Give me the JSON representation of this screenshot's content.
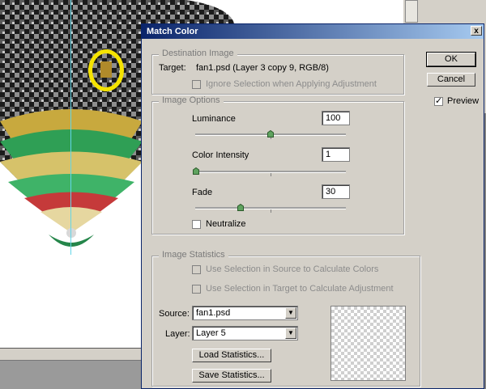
{
  "dialog": {
    "title": "Match Color",
    "close_glyph": "x",
    "ok_label": "OK",
    "cancel_label": "Cancel",
    "preview_label": "Preview",
    "preview_checked": true
  },
  "destination": {
    "legend": "Destination Image",
    "target_label": "Target:",
    "target_value": "fan1.psd (Layer 3 copy 9, RGB/8)",
    "ignore_selection_label": "Ignore Selection when Applying Adjustment"
  },
  "options": {
    "legend": "Image Options",
    "luminance_label": "Luminance",
    "luminance_value": "100",
    "color_intensity_label": "Color Intensity",
    "color_intensity_value": "1",
    "fade_label": "Fade",
    "fade_value": "30",
    "neutralize_label": "Neutralize"
  },
  "statistics": {
    "legend": "Image Statistics",
    "use_source_label": "Use Selection in Source to Calculate Colors",
    "use_target_label": "Use Selection in Target to Calculate Adjustment",
    "source_label": "Source:",
    "source_value": "fan1.psd",
    "layer_label": "Layer:",
    "layer_value": "Layer 5",
    "load_label": "Load Statistics...",
    "save_label": "Save Statistics..."
  },
  "icons": {
    "close": "close-icon",
    "dropdown": "chevron-down-icon",
    "check": "checkmark-icon",
    "slider_thumb": "slider-thumb-icon"
  },
  "colors": {
    "title_bar_start": "#0a246a",
    "title_bar_end": "#a6caf0",
    "dialog_face": "#d4d0c8",
    "highlight_marker": "#f5e300",
    "guide_line": "#63d6e8"
  }
}
